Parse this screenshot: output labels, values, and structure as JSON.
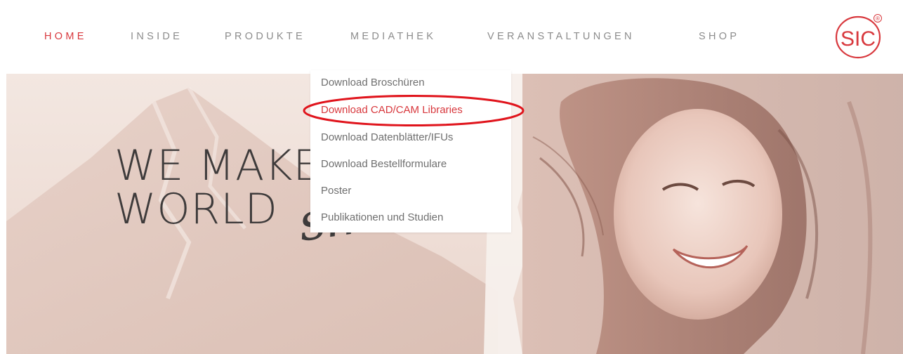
{
  "nav": {
    "items": [
      {
        "label": "HOME",
        "active": true
      },
      {
        "label": "INSIDE"
      },
      {
        "label": "PRODUKTE"
      },
      {
        "label": "MEDIATHEK"
      },
      {
        "label": "VERANSTALTUNGEN"
      },
      {
        "label": "SHOP"
      }
    ]
  },
  "logo": {
    "text": "SIC",
    "mark": "®"
  },
  "dropdown": {
    "items": [
      {
        "label": "Download Broschüren"
      },
      {
        "label": "Download CAD/CAM Libraries",
        "highlighted": true
      },
      {
        "label": "Download Datenblätter/IFUs"
      },
      {
        "label": "Download Bestellformulare"
      },
      {
        "label": "Poster"
      },
      {
        "label": "Publikationen und Studien"
      }
    ]
  },
  "hero": {
    "headline_line1": "WE MAKE THE",
    "headline_line2": "WORLD",
    "headline_script": "smile"
  },
  "colors": {
    "accent": "#d8383d",
    "nav_text": "#8c8c8c",
    "headline": "#3e3b3b",
    "hero_tint": "#efe0d9"
  }
}
